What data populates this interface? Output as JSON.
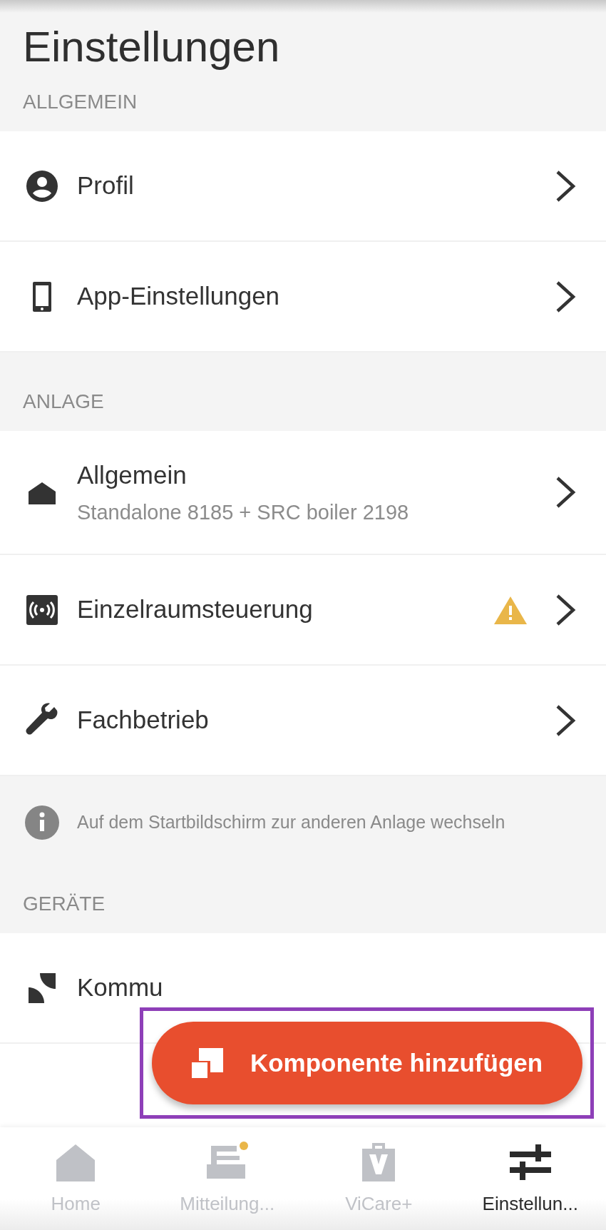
{
  "title": "Einstellungen",
  "sections": [
    {
      "header": "ALLGEMEIN",
      "items": [
        {
          "kind": "person",
          "label": "Profil",
          "warning": false,
          "chevron": true
        },
        {
          "kind": "phone",
          "label": "App-Einstellungen",
          "warning": false,
          "chevron": true
        }
      ]
    },
    {
      "header": "ANLAGE",
      "items": [
        {
          "kind": "house",
          "label": "Allgemein",
          "subtitle": "Standalone 8185 + SRC boiler 2198",
          "warning": false,
          "chevron": true
        },
        {
          "kind": "radio",
          "label": "Einzelraumsteuerung",
          "warning": true,
          "chevron": true
        },
        {
          "kind": "wrench",
          "label": "Fachbetrieb",
          "warning": false,
          "chevron": true
        }
      ],
      "note": "Auf dem Startbildschirm zur anderen Anlage wechseln"
    },
    {
      "header": "GERÄTE",
      "items": [
        {
          "kind": "device",
          "label": "Kommu"
        }
      ]
    }
  ],
  "fab": {
    "label": "Komponente hinzufügen"
  },
  "bottom_nav": [
    {
      "kind": "home",
      "label": "Home",
      "selected": false,
      "unread": false
    },
    {
      "kind": "inbox",
      "label": "Mitteilung...",
      "selected": false,
      "unread": true
    },
    {
      "kind": "bag",
      "label": "ViCare+",
      "selected": false,
      "unread": false
    },
    {
      "kind": "sliders",
      "label": "Einstellun...",
      "selected": true,
      "unread": false
    }
  ]
}
